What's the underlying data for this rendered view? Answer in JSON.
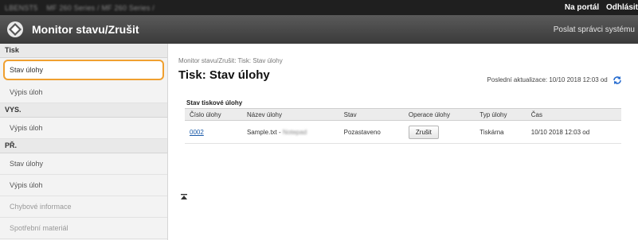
{
  "topbar": {
    "breadcrumb_left": "LBENST5",
    "breadcrumb_mid": "MF 260 Series / MF 260 Series /",
    "portal_link": "Na portál",
    "logout_link": "Odhlásit"
  },
  "header": {
    "title": "Monitor stavu/Zrušit",
    "admin_link": "Poslat správci systému"
  },
  "sidebar": {
    "sections": [
      {
        "heading": "Tisk",
        "items": [
          "Stav úlohy",
          "Výpis úloh"
        ]
      },
      {
        "heading": "VYS.",
        "items": [
          "Výpis úloh"
        ]
      },
      {
        "heading": "PŘ.",
        "items": [
          "Stav úlohy",
          "Výpis úloh"
        ]
      }
    ],
    "extra_items": [
      "Chybové informace",
      "Spotřební materiál"
    ],
    "active_item": "Stav úlohy"
  },
  "main": {
    "breadcrumb": "Monitor stavu/Zrušit: Tisk: Stav úlohy",
    "page_title": "Tisk: Stav úlohy",
    "last_update": "Poslední aktualizace: 10/10 2018 12:03 od",
    "table_caption": "Stav tiskové úlohy",
    "columns": [
      "Číslo úlohy",
      "Název úlohy",
      "Stav",
      "Operace úlohy",
      "Typ úlohy",
      "Čas"
    ],
    "rows": [
      {
        "job_no": "0002",
        "job_name": "Sample.txt -",
        "job_name_blur": "Notepad",
        "status": "Pozastaveno",
        "action": "Zrušit",
        "type": "Tiskárna",
        "time": "10/10 2018 12:03 od"
      }
    ]
  }
}
